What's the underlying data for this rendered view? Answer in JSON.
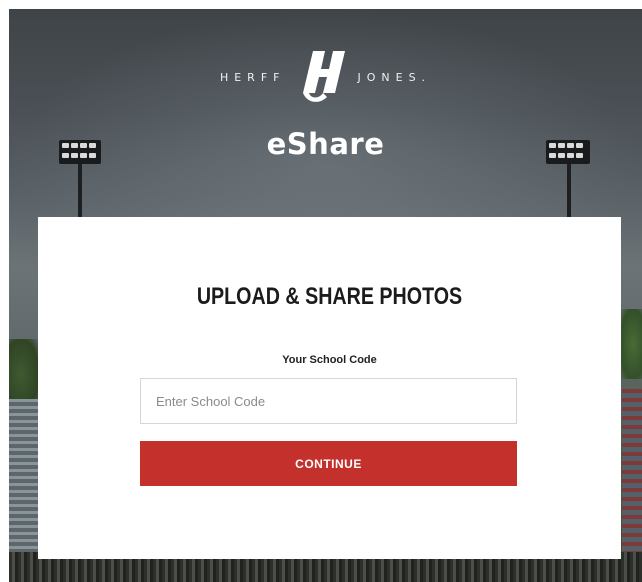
{
  "brand": {
    "left_word": "HERFF",
    "right_word": "JONES.",
    "logo_icon": "herff-jones-hj-monogram"
  },
  "app": {
    "title": "eShare"
  },
  "form": {
    "heading": "UPLOAD & SHARE PHOTOS",
    "field_label": "Your School Code",
    "field_placeholder": "Enter School Code",
    "field_value": "",
    "submit_label": "CONTINUE"
  },
  "colors": {
    "accent": "#c4302b",
    "card_background": "#ffffff",
    "heading_text": "#1b1b1b"
  }
}
